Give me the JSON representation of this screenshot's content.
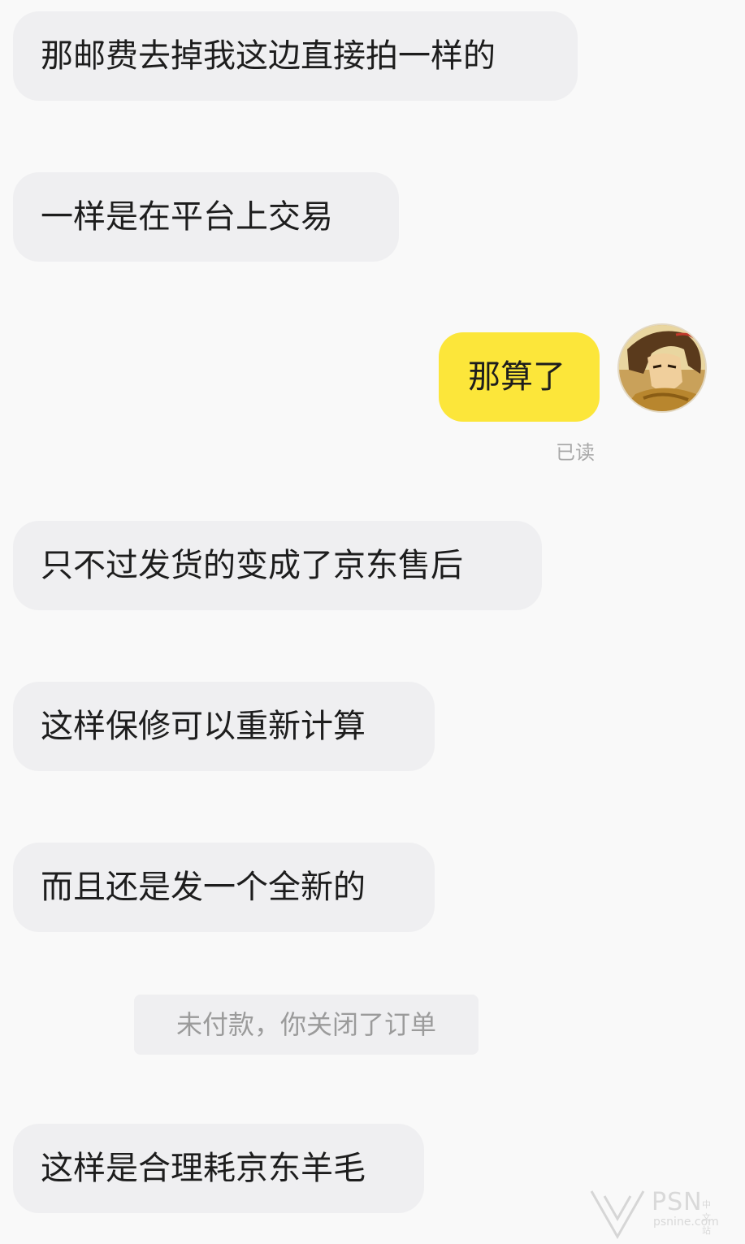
{
  "messages": [
    {
      "id": "m1",
      "side": "in",
      "text": "那邮费去掉我这边直接拍一样的"
    },
    {
      "id": "m2",
      "side": "in",
      "text": "一样是在平台上交易"
    },
    {
      "id": "m3",
      "side": "out",
      "text": "那算了",
      "status": "已读"
    },
    {
      "id": "m4",
      "side": "in",
      "text": "只不过发货的变成了京东售后"
    },
    {
      "id": "m5",
      "side": "in",
      "text": "这样保修可以重新计算"
    },
    {
      "id": "m6",
      "side": "in",
      "text": "而且还是发一个全新的"
    },
    {
      "id": "m7",
      "side": "in",
      "text": "这样是合理耗京东羊毛"
    }
  ],
  "system_notice": "未付款，你关闭了订单",
  "watermark": {
    "brand": "PSN",
    "brand_cn": "中文站",
    "site": "psnine.com"
  },
  "colors": {
    "outgoing_bubble": "#fce63a",
    "incoming_bubble": "#efeff1",
    "background": "#f9f9f9"
  }
}
